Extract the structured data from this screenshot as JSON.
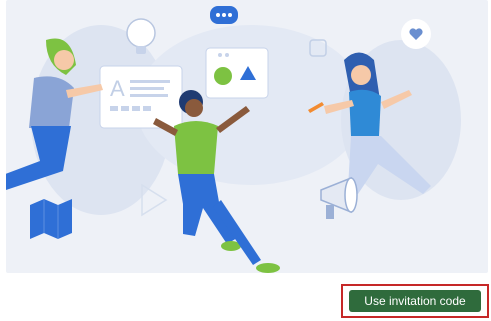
{
  "illustration": {
    "description_icon": "collaboration-illustration",
    "colors": {
      "background": "#eef1f7",
      "accent_blue": "#2f6fd6",
      "accent_green": "#7dc242",
      "accent_orange": "#f28b30"
    }
  },
  "footer": {
    "invite_button_label": "Use invitation code",
    "invite_button_color": "#2f6b3c",
    "highlight_color": "#c62828"
  }
}
